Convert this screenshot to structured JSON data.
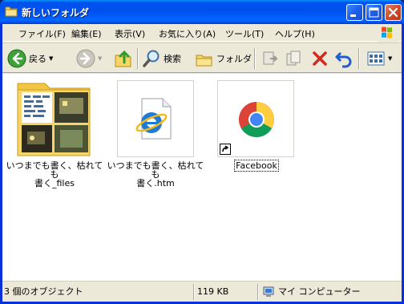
{
  "window": {
    "title": "新しいフォルダ",
    "icon": "folder-icon"
  },
  "titlebar_buttons": [
    "minimize",
    "maximize",
    "close"
  ],
  "menu": {
    "items": [
      {
        "label": "ファイル(F)"
      },
      {
        "label": "編集(E)"
      },
      {
        "label": "表示(V)"
      },
      {
        "label": "お気に入り(A)"
      },
      {
        "label": "ツール(T)"
      },
      {
        "label": "ヘルプ(H)"
      }
    ]
  },
  "toolbar": {
    "back_label": "戻る",
    "search_label": "検索",
    "folders_label": "フォルダ"
  },
  "files": [
    {
      "name_line1": "いつまでも書く、枯れても",
      "name_line2": "書く_files",
      "type": "folder-with-thumbnails",
      "icon": "folder-icon"
    },
    {
      "name_line1": "いつまでも書く、枯れても",
      "name_line2": "書く.htm",
      "type": "html-document",
      "icon": "internet-explorer-icon"
    },
    {
      "name_line1": "Facebook",
      "name_line2": "",
      "type": "shortcut",
      "icon": "chrome-icon",
      "selected": true
    }
  ],
  "status": {
    "objects": "3 個のオブジェクト",
    "size": "119 KB",
    "location": "マイ コンピューター"
  },
  "colors": {
    "title_blue": "#0054e3",
    "frame_beige": "#ece9d8",
    "close_red": "#d34b26",
    "folder_yellow": "#f7d569"
  }
}
